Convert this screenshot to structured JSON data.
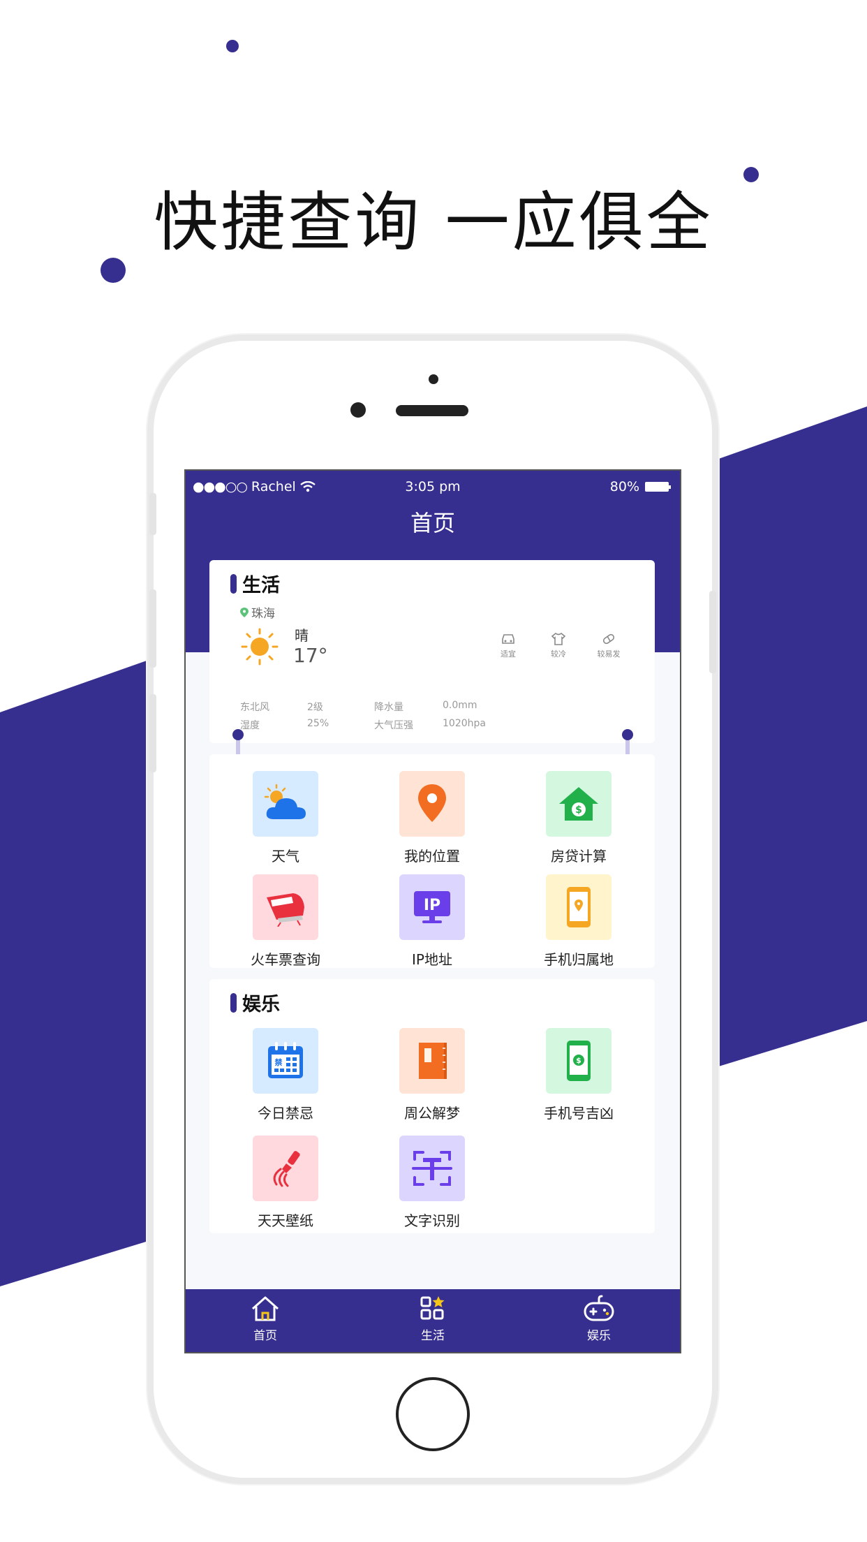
{
  "headline": "快捷查询  一应俱全",
  "colors": {
    "brand": "#372f8f",
    "tab_bg": "#372f8f",
    "accent_yellow": "#f5c518"
  },
  "status_bar": {
    "carrier": "Rachel",
    "time": "3:05 pm",
    "battery": "80%"
  },
  "header": {
    "title": "首页"
  },
  "life": {
    "title": "生活",
    "weather": {
      "city": "珠海",
      "condition": "晴",
      "temperature": "17°",
      "indices": [
        {
          "icon": "car-icon",
          "label": "适宜"
        },
        {
          "icon": "shirt-icon",
          "label": "较冷"
        },
        {
          "icon": "pill-icon",
          "label": "较易发"
        }
      ],
      "stats": [
        {
          "label": "东北风",
          "value": "2级"
        },
        {
          "label": "降水量",
          "value": "0.0mm"
        },
        {
          "label": "湿度",
          "value": "25%"
        },
        {
          "label": "大气压强",
          "value": "1020hpa"
        }
      ]
    },
    "items": [
      {
        "label": "天气",
        "icon": "weather-cloud-icon",
        "bg": "#d6ebff"
      },
      {
        "label": "我的位置",
        "icon": "location-pin-icon",
        "bg": "#ffe3d4"
      },
      {
        "label": "房贷计算",
        "icon": "house-money-icon",
        "bg": "#d4f7e0"
      },
      {
        "label": "火车票查询",
        "icon": "train-icon",
        "bg": "#ffd9de"
      },
      {
        "label": "IP地址",
        "icon": "ip-monitor-icon",
        "bg": "#dcd6ff"
      },
      {
        "label": "手机归属地",
        "icon": "phone-location-icon",
        "bg": "#fff4cc"
      }
    ]
  },
  "fun": {
    "title": "娱乐",
    "items": [
      {
        "label": "今日禁忌",
        "icon": "calendar-icon",
        "bg": "#d6ebff"
      },
      {
        "label": "周公解梦",
        "icon": "book-icon",
        "bg": "#ffe3d4"
      },
      {
        "label": "手机号吉凶",
        "icon": "phone-money-icon",
        "bg": "#d4f7e0"
      },
      {
        "label": "天天壁纸",
        "icon": "brush-icon",
        "bg": "#ffd9de"
      },
      {
        "label": "文字识别",
        "icon": "text-scan-icon",
        "bg": "#dcd6ff"
      }
    ]
  },
  "tabs": [
    {
      "label": "首页",
      "icon": "home-icon"
    },
    {
      "label": "生活",
      "icon": "apps-icon"
    },
    {
      "label": "娱乐",
      "icon": "gamepad-icon"
    }
  ]
}
